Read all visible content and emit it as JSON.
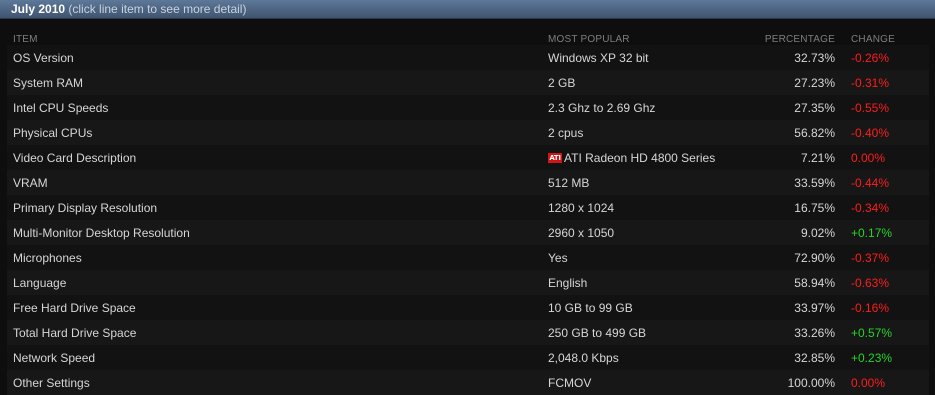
{
  "header": {
    "month": "July 2010",
    "hint": "(click line item to see more detail)"
  },
  "columns": {
    "item": "ITEM",
    "most_popular": "MOST POPULAR",
    "percentage": "PERCENTAGE",
    "change": "CHANGE"
  },
  "colors": {
    "negative": "#ff1c1c",
    "positive": "#25d425",
    "title_bar": "#4c6482"
  },
  "rows": [
    {
      "item": "OS Version",
      "popular": "Windows XP 32 bit",
      "percent": "32.73%",
      "change": "-0.26%"
    },
    {
      "item": "System RAM",
      "popular": "2 GB",
      "percent": "27.23%",
      "change": "-0.31%"
    },
    {
      "item": "Intel CPU Speeds",
      "popular": "2.3 Ghz to 2.69 Ghz",
      "percent": "27.35%",
      "change": "-0.55%"
    },
    {
      "item": "Physical CPUs",
      "popular": "2 cpus",
      "percent": "56.82%",
      "change": "-0.40%"
    },
    {
      "item": "Video Card Description",
      "popular": "ATI Radeon HD 4800 Series",
      "logo": "ATI",
      "percent": "7.21%",
      "change": "0.00%"
    },
    {
      "item": "VRAM",
      "popular": "512 MB",
      "percent": "33.59%",
      "change": "-0.44%"
    },
    {
      "item": "Primary Display Resolution",
      "popular": "1280 x 1024",
      "percent": "16.75%",
      "change": "-0.34%"
    },
    {
      "item": "Multi-Monitor Desktop Resolution",
      "popular": "2960 x 1050",
      "percent": "9.02%",
      "change": "+0.17%"
    },
    {
      "item": "Microphones",
      "popular": "Yes",
      "percent": "72.90%",
      "change": "-0.37%"
    },
    {
      "item": "Language",
      "popular": "English",
      "percent": "58.94%",
      "change": "-0.63%"
    },
    {
      "item": "Free Hard Drive Space",
      "popular": "10 GB to 99 GB",
      "percent": "33.97%",
      "change": "-0.16%"
    },
    {
      "item": "Total Hard Drive Space",
      "popular": "250 GB to 499 GB",
      "percent": "33.26%",
      "change": "+0.57%"
    },
    {
      "item": "Network Speed",
      "popular": "2,048.0 Kbps",
      "percent": "32.85%",
      "change": "+0.23%"
    },
    {
      "item": "Other Settings",
      "popular": "FCMOV",
      "percent": "100.00%",
      "change": "0.00%"
    }
  ]
}
